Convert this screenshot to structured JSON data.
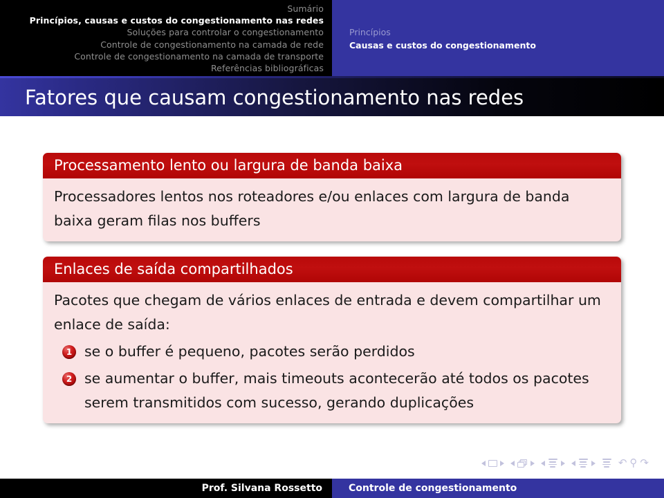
{
  "header": {
    "sections": [
      {
        "label": "Sumário",
        "current": false
      },
      {
        "label": "Princípios, causas e custos do congestionamento nas redes",
        "current": true
      },
      {
        "label": "Soluções para controlar o congestionamento",
        "current": false
      },
      {
        "label": "Controle de congestionamento na camada de rede",
        "current": false
      },
      {
        "label": "Controle de congestionamento na camada de transporte",
        "current": false
      },
      {
        "label": "Referências bibliográficas",
        "current": false
      }
    ],
    "subsections": [
      {
        "label": "Princípios",
        "current": false
      },
      {
        "label": "Causas e custos do congestionamento",
        "current": true
      }
    ]
  },
  "frame": {
    "title": "Fatores que causam congestionamento nas redes"
  },
  "blocks": [
    {
      "title": "Processamento lento ou largura de banda baixa",
      "paragraph": "Processadores lentos nos roteadores e/ou enlaces com largura de banda baixa geram filas nos buffers",
      "items": []
    },
    {
      "title": "Enlaces de saída compartilhados",
      "paragraph": "Pacotes que chegam de vários enlaces de entrada e devem compartilhar um enlace de saída:",
      "items": [
        {
          "number": "1",
          "text": "se o buffer é pequeno, pacotes serão perdidos"
        },
        {
          "number": "2",
          "text": "se aumentar o buffer, mais timeouts acontecerão até todos os pacotes serem transmitidos com sucesso, gerando duplicações"
        }
      ]
    }
  ],
  "navsymbols": {
    "groups": [
      {
        "icon": "slide-icon",
        "label": "slide"
      },
      {
        "icon": "frame-icon",
        "label": "frame"
      },
      {
        "icon": "subsection-icon",
        "label": "subsection"
      },
      {
        "icon": "section-icon",
        "label": "section"
      }
    ],
    "doc_icon": "document-icon",
    "back_icon": "back-arrow-icon",
    "search_icon": "search-icon",
    "forward_icon": "forward-arrow-icon",
    "back_glyph": "↶",
    "search_glyph": "⚲",
    "forward_glyph": "↷"
  },
  "footer": {
    "author": "Prof. Silvana Rossetto",
    "title": "Controle de congestionamento"
  },
  "colors": {
    "nav_blue": "#3434a0",
    "nav_black": "#000000",
    "block_red": "#c00f0f",
    "block_pink": "#fae3e4",
    "muted_nav": "#8f8f8f",
    "muted_sub": "#9a9ad0"
  }
}
